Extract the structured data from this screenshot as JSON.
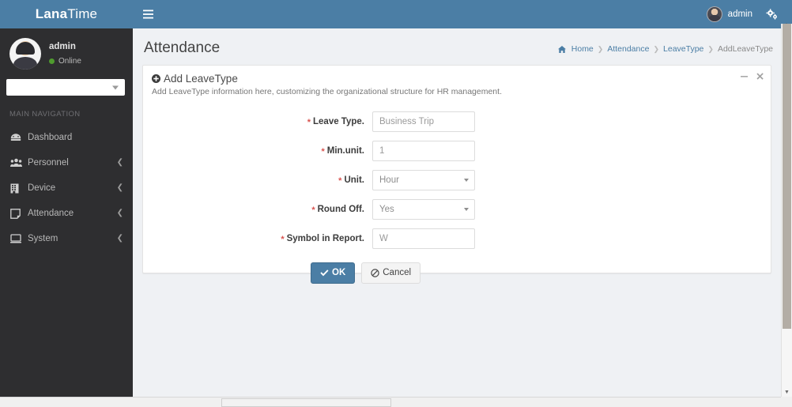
{
  "logo": {
    "bold": "Lana",
    "light": "Time"
  },
  "header": {
    "menu_toggle_icon": "hamburger-icon",
    "user_label": "admin",
    "settings_icon": "cogs-icon"
  },
  "sidebar": {
    "user": {
      "name": "admin",
      "status": "Online"
    },
    "selector_value": "",
    "nav_header": "MAIN NAVIGATION",
    "items": [
      {
        "label": "Dashboard",
        "icon": "dashboard-icon",
        "has_chevron": false
      },
      {
        "label": "Personnel",
        "icon": "users-icon",
        "has_chevron": true
      },
      {
        "label": "Device",
        "icon": "device-icon",
        "has_chevron": true
      },
      {
        "label": "Attendance",
        "icon": "note-icon",
        "has_chevron": true
      },
      {
        "label": "System",
        "icon": "desktop-icon",
        "has_chevron": true
      }
    ]
  },
  "content": {
    "page_title": "Attendance",
    "breadcrumb": [
      {
        "label": "Home",
        "icon": "home-icon",
        "active": false
      },
      {
        "label": "Attendance",
        "active": false
      },
      {
        "label": "LeaveType",
        "active": false
      },
      {
        "label": "AddLeaveType",
        "active": true
      }
    ]
  },
  "panel": {
    "title": "Add LeaveType",
    "title_icon": "plus-circle-icon",
    "description": "Add LeaveType information here, customizing the organizational structure for HR management.",
    "collapse_icon": "minus-icon",
    "close_icon": "close-icon"
  },
  "form": {
    "fields": [
      {
        "label": "Leave Type.",
        "required": true,
        "type": "text",
        "value": "Business Trip",
        "placeholder": "Business Trip"
      },
      {
        "label": "Min.unit.",
        "required": true,
        "type": "text",
        "value": "1",
        "placeholder": "1"
      },
      {
        "label": "Unit.",
        "required": true,
        "type": "select",
        "value": "Hour",
        "options": [
          "Hour"
        ]
      },
      {
        "label": "Round Off.",
        "required": true,
        "type": "select",
        "value": "Yes",
        "options": [
          "Yes"
        ]
      },
      {
        "label": "Symbol in Report.",
        "required": true,
        "type": "text",
        "value": "W",
        "placeholder": "W"
      }
    ],
    "submit_label": "OK",
    "submit_icon": "check-icon",
    "cancel_label": "Cancel",
    "cancel_icon": "ban-icon"
  },
  "colors": {
    "brand_blue": "#4b7ea5",
    "sidebar_dark": "#2e2e30",
    "content_bg": "#eff1f4",
    "required_red": "#d9534f",
    "online_green": "#4f9b2e"
  }
}
